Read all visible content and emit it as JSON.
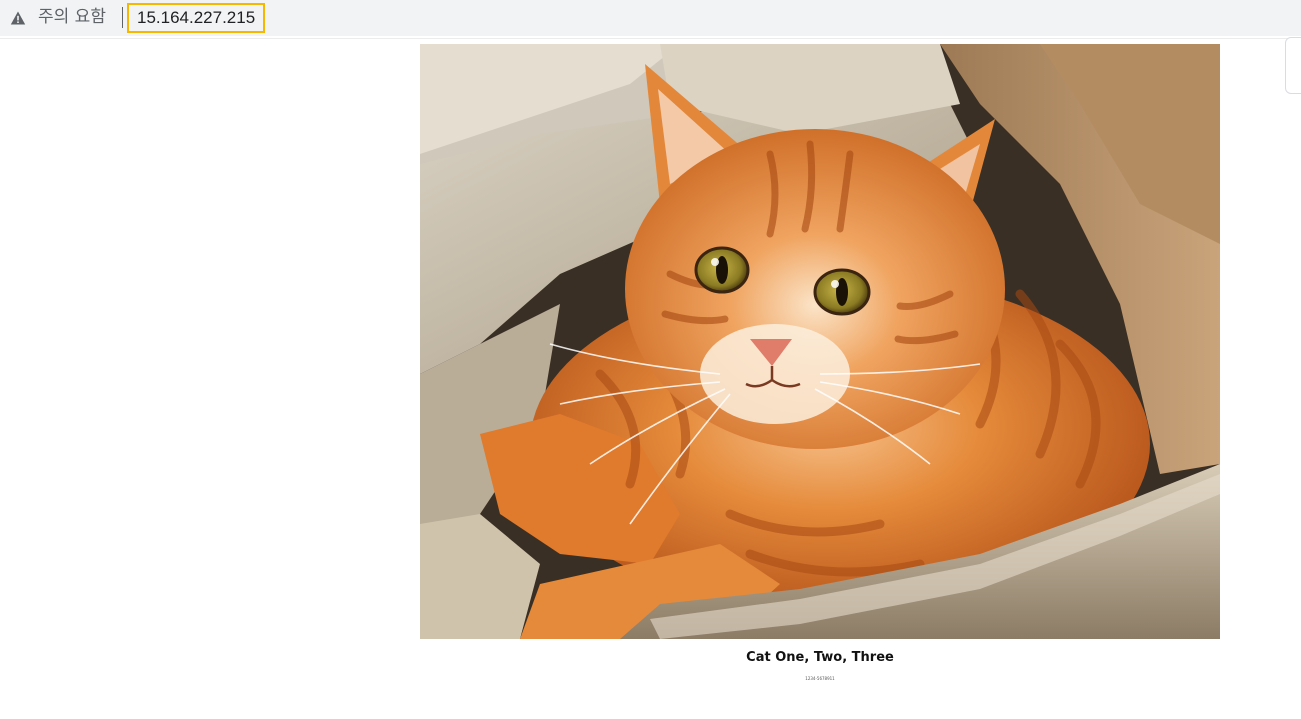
{
  "browser": {
    "security_warning": "주의 요함",
    "separator": "|",
    "url": "15.164.227.215"
  },
  "main": {
    "image": {
      "subject": "orange tabby cat lying in a beige fluffy cat bed",
      "accent_colors": [
        "#d97a2b",
        "#c9b79a"
      ]
    },
    "caption": "Cat One, Two, Three",
    "subcaption": "1234-5678911"
  },
  "colors": {
    "url_highlight": "#f5b800",
    "toolbar_bg": "#f1f3f4"
  }
}
